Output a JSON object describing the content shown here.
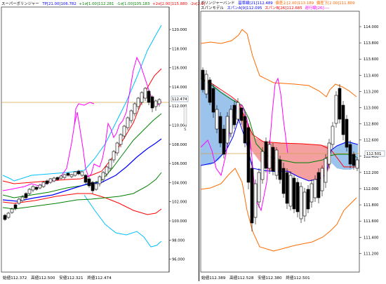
{
  "left_panel": {
    "header": {
      "segments": [
        {
          "text": "スーパーボリンジャー",
          "color": "#000000"
        },
        {
          "text": "TP[21.00]106.782",
          "color": "#0000ff"
        },
        {
          "text": "+1σ[1.00]112.281",
          "color": "#008000"
        },
        {
          "text": "-1σ[1.00]105.183",
          "color": "#008000"
        },
        {
          "text": "+2σ[2.00]115.880",
          "color": "#ff0000"
        },
        {
          "text": "-2σ[2.0]",
          "color": "#ff0000"
        }
      ]
    },
    "price_axis": [
      "120.000",
      "118.000",
      "116.000",
      "114.000",
      "112.000",
      "110.000",
      "108.000",
      "106.000",
      "104.000",
      "102.000",
      "100.000",
      "98.000",
      "96.000"
    ],
    "current_price": "112.474",
    "side_marker": "S",
    "footer": {
      "open": "始値112.372",
      "high": "高値112.500",
      "low": "安値112.321",
      "close": "終値112.474"
    }
  },
  "right_panel": {
    "header": {
      "line1": [
        {
          "text": "ボリンジャーバンド",
          "color": "#000000"
        },
        {
          "text": "基準線[21]112.489",
          "color": "#0000ff"
        },
        {
          "text": "偏差上[2.00]113.189",
          "color": "#ff6600"
        },
        {
          "text": "偏差下[2.00]111.809",
          "color": "#ff6600"
        }
      ],
      "line2": [
        {
          "text": "スパンモデル",
          "color": "#000000"
        },
        {
          "text": "スパンA[9]112.095",
          "color": "#0000ff"
        },
        {
          "text": "スパンB[26]112.685",
          "color": "#ff0000"
        },
        {
          "text": "遅行線[26]----",
          "color": "#ff00ff"
        }
      ]
    },
    "price_axis": [
      "114.000",
      "113.800",
      "113.600",
      "113.400",
      "113.200",
      "113.000",
      "112.800",
      "112.600",
      "112.400",
      "112.200",
      "112.000",
      "111.800",
      "111.600",
      "111.400",
      "111.200"
    ],
    "current_price": "112.501",
    "footer": {
      "open": "始値112.389",
      "high": "高値112.528",
      "low": "安値112.380",
      "close": "終値112.501"
    }
  },
  "colors": {
    "upper2": "#ff0000",
    "upper1": "#008000",
    "middle": "#0000ff",
    "upper3": "#00bfff",
    "lagging": "#ff00ff",
    "price_line": "#d2a14a",
    "bb_outer": "#ff6a00",
    "span_up": "#9cc3ec",
    "span_down": "#f4a0a0"
  }
}
